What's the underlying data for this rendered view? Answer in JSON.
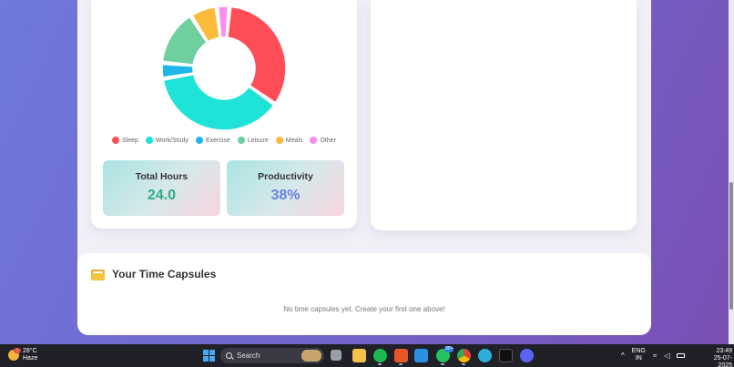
{
  "chart_data": {
    "type": "pie",
    "style": "donut",
    "categories": [
      "Sleep",
      "Work/Study",
      "Exercise",
      "Leisure",
      "Meals",
      "Other"
    ],
    "values": [
      8,
      9,
      1,
      3.5,
      1.7,
      0.8
    ],
    "colors": [
      "#ff4d57",
      "#1ee3d6",
      "#1fb6e8",
      "#6fcf9e",
      "#fdbb3c",
      "#f78ef0"
    ],
    "legend_position": "bottom"
  },
  "stats": {
    "total_hours_label": "Total Hours",
    "total_hours_value": "24.0",
    "productivity_label": "Productivity",
    "productivity_value": "38%"
  },
  "capsules": {
    "title": "Your Time Capsules",
    "empty_message": "No time capsules yet. Create your first one above!"
  },
  "taskbar": {
    "weather_temp": "28°C",
    "weather_desc": "Haze",
    "weather_badge": "1",
    "search_label": "Search",
    "notification_badge": "99+",
    "lang_primary": "ENG",
    "lang_secondary": "IN",
    "time": "23:49",
    "date": "25-07-2025"
  }
}
